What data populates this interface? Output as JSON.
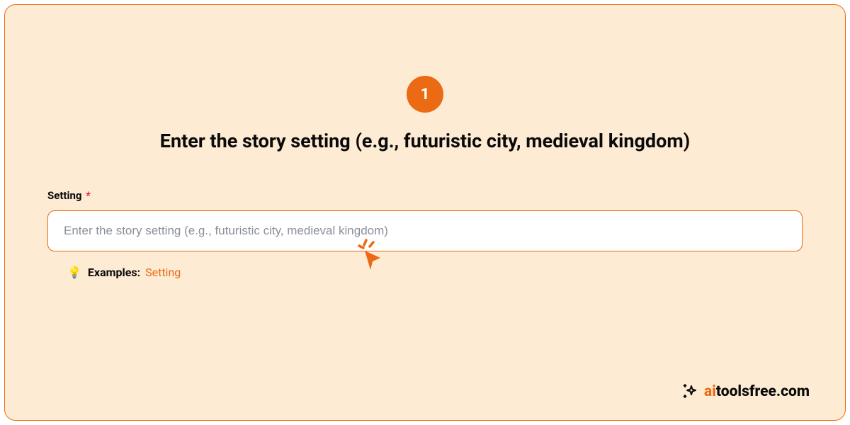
{
  "step": {
    "number": "1",
    "heading": "Enter the story setting (e.g., futuristic city, medieval kingdom)"
  },
  "form": {
    "label": "Setting",
    "required_mark": "*",
    "placeholder": "Enter the story setting (e.g., futuristic city, medieval kingdom)"
  },
  "examples": {
    "icon": "💡",
    "label": "Examples:",
    "link_text": "Setting"
  },
  "brand": {
    "prefix": "ai",
    "suffix": "toolsfree.com"
  },
  "colors": {
    "accent": "#ec6a13",
    "card_bg": "#fdebd3"
  }
}
